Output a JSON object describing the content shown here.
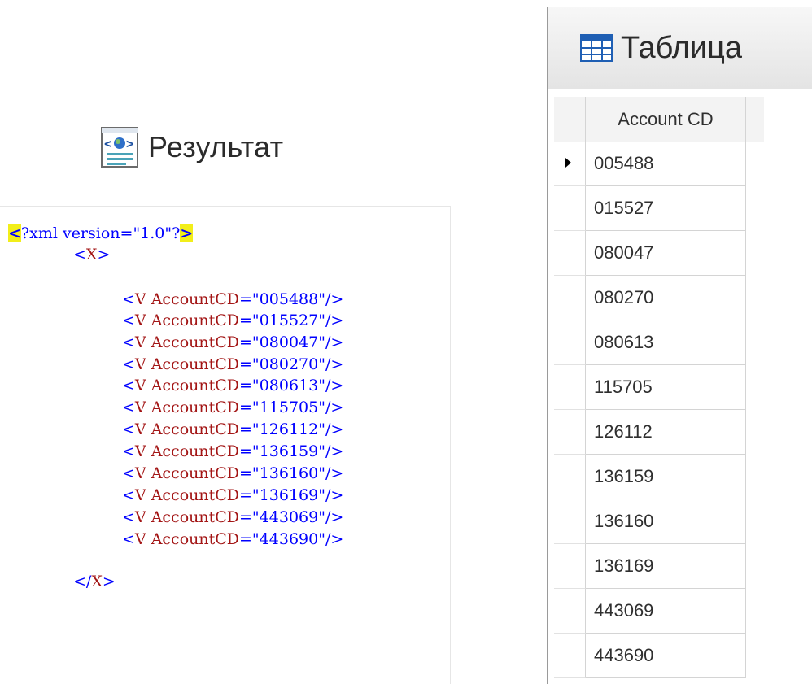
{
  "result_panel": {
    "title": "Результат",
    "icon": "xml-document-icon",
    "xml_lines": [
      {
        "kind": "declaration",
        "text": "?xml version=\"1.0\"?"
      },
      {
        "kind": "open",
        "tag": "X"
      },
      {
        "kind": "element",
        "tag": "V",
        "attr": "AccountCD",
        "value": "005488"
      },
      {
        "kind": "element",
        "tag": "V",
        "attr": "AccountCD",
        "value": "015527"
      },
      {
        "kind": "element",
        "tag": "V",
        "attr": "AccountCD",
        "value": "080047"
      },
      {
        "kind": "element",
        "tag": "V",
        "attr": "AccountCD",
        "value": "080270"
      },
      {
        "kind": "element",
        "tag": "V",
        "attr": "AccountCD",
        "value": "080613"
      },
      {
        "kind": "element",
        "tag": "V",
        "attr": "AccountCD",
        "value": "115705"
      },
      {
        "kind": "element",
        "tag": "V",
        "attr": "AccountCD",
        "value": "126112"
      },
      {
        "kind": "element",
        "tag": "V",
        "attr": "AccountCD",
        "value": "136159"
      },
      {
        "kind": "element",
        "tag": "V",
        "attr": "AccountCD",
        "value": "136160"
      },
      {
        "kind": "element",
        "tag": "V",
        "attr": "AccountCD",
        "value": "136169"
      },
      {
        "kind": "element",
        "tag": "V",
        "attr": "AccountCD",
        "value": "443069"
      },
      {
        "kind": "element",
        "tag": "V",
        "attr": "AccountCD",
        "value": "443690"
      },
      {
        "kind": "close",
        "tag": "X"
      }
    ]
  },
  "table_panel": {
    "title": "Таблица",
    "icon": "table-grid-icon",
    "column_header": "Account CD",
    "current_row_index": 0,
    "rows": [
      "005488",
      "015527",
      "080047",
      "080270",
      "080613",
      "115705",
      "126112",
      "136159",
      "136160",
      "136169",
      "443069",
      "443690"
    ]
  },
  "colors": {
    "xml_bracket": "#0000ff",
    "xml_tag": "#a31515",
    "xml_value": "#0000ff",
    "declaration_highlight": "#f2ee1a"
  }
}
